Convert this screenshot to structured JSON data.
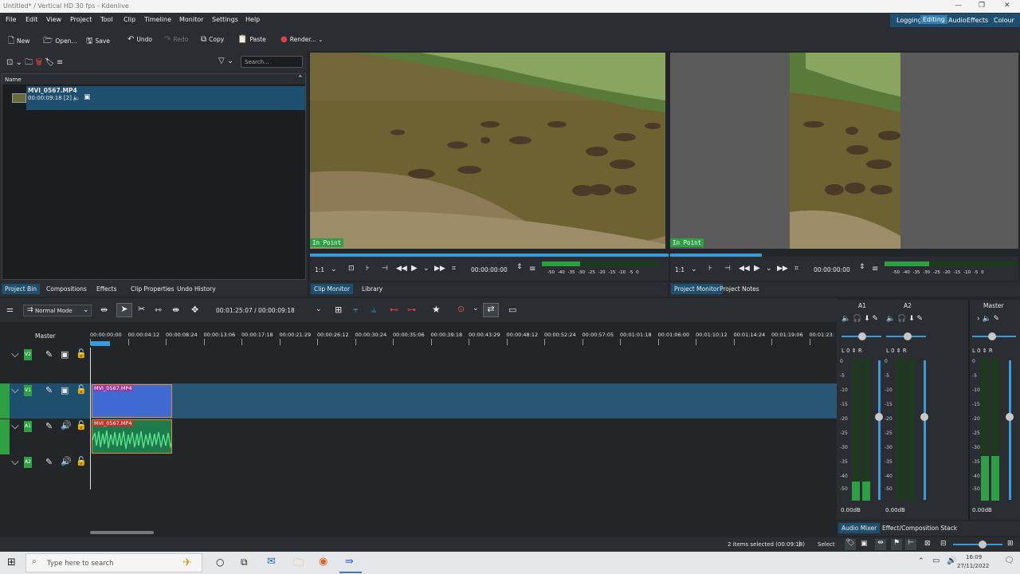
{
  "window": {
    "title": "Untitled* / Vertical HD 30 fps - Kdenlive",
    "min": "—",
    "max": "❐",
    "close": "✕"
  },
  "menu": [
    "File",
    "Edit",
    "View",
    "Project",
    "Tool",
    "Clip",
    "Timeline",
    "Monitor",
    "Settings",
    "Help"
  ],
  "layouts": [
    "Logging",
    "Editing",
    "Audio",
    "Effects",
    "Colour"
  ],
  "toolbar": {
    "new": "New",
    "open": "Open...",
    "save": "Save",
    "undo": "Undo",
    "redo": "Redo",
    "copy": "Copy",
    "paste": "Paste",
    "render": "Render..."
  },
  "bin": {
    "search_placeholder": "Search...",
    "col_name": "Name",
    "clip_name": "MVI_0567.MP4",
    "clip_duration": "00:00:09:18 [2]"
  },
  "bin_tabs": [
    "Project Bin",
    "Compositions",
    "Effects",
    "Clip Properties",
    "Undo History"
  ],
  "clip_monitor": {
    "in_point": "In Point",
    "zoom": "1:1",
    "timecode": "00:00:00:00",
    "scale": "-50 -40 -35 -30 -25 -20 -15 -10 -5 0"
  },
  "project_monitor": {
    "in_point": "In Point",
    "zoom": "1:1",
    "timecode": "00:00:00:00",
    "scale": "-50 -40 -35 -30 -25 -20 -15 -10 -5 0"
  },
  "monitor_tabs": [
    "Clip Monitor",
    "Library"
  ],
  "project_tabs": [
    "Project Monitor",
    "Project Notes"
  ],
  "timeline": {
    "mode": "Normal Mode",
    "position": "00:01:25:07 / 00:00:09:18",
    "master": "Master",
    "ruler": [
      "00:00:00:00",
      "00:00:04:12",
      "00:00:08:24",
      "00:00:13:06",
      "00:00:17:18",
      "00:00:21:29",
      "00:00:26:12",
      "00:00:30:24",
      "00:00:35:06",
      "00:00:39:18",
      "00:00:43:29",
      "00:00:48:12",
      "00:00:52:24",
      "00:00:57:05",
      "00:01:01:18",
      "00:01:06:00",
      "00:01:10:12",
      "00:01:14:24",
      "00:01:19:06",
      "00:01:23:"
    ],
    "tracks": [
      "V2",
      "V1",
      "A1",
      "A2"
    ],
    "video_clip": "MVI_0567.MP4",
    "audio_clip": "MVI_0567.MP4"
  },
  "mixer": {
    "a1": "A1",
    "a2": "A2",
    "master": "Master",
    "db1": "0.00dB",
    "db2": "0.00dB",
    "db3": "0.00dB",
    "scale": [
      "0",
      "-5",
      "-10",
      "-15",
      "-20",
      "-25",
      "-30",
      "-35",
      "-40",
      "-50"
    ]
  },
  "mixer_tabs": [
    "Audio Mixer",
    "Effect/Composition Stack"
  ],
  "status": {
    "selection": "2 items selected (00:09:18)",
    "sep": "|",
    "select": "Select"
  },
  "taskbar": {
    "search": "Type here to search",
    "time": "16:09",
    "date": "27/11/2022"
  }
}
